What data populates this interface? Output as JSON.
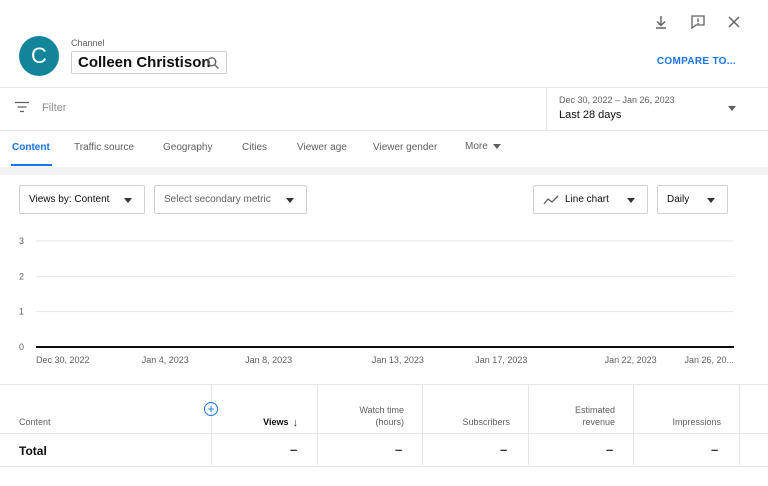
{
  "window": {
    "icons": [
      "download-icon",
      "feedback-icon",
      "close-icon"
    ]
  },
  "header": {
    "avatar_letter": "C",
    "avatar_color": "#12859a",
    "channel_label": "Channel",
    "channel_name": "Colleen Christison",
    "compare_label": "COMPARE TO..."
  },
  "filter": {
    "placeholder": "Filter"
  },
  "date": {
    "range": "Dec 30, 2022 – Jan 26, 2023",
    "label": "Last 28 days"
  },
  "tabs": [
    {
      "label": "Content",
      "active": true
    },
    {
      "label": "Traffic source"
    },
    {
      "label": "Geography"
    },
    {
      "label": "Cities"
    },
    {
      "label": "Viewer age"
    },
    {
      "label": "Viewer gender"
    },
    {
      "label": "More"
    }
  ],
  "controls": {
    "primary_metric": "Views by: Content",
    "secondary_metric": "Select secondary metric",
    "chart_type": "Line chart",
    "granularity": "Daily"
  },
  "chart_data": {
    "type": "line",
    "x_tick_labels": [
      "Dec 30, 2022",
      "Jan 4, 2023",
      "Jan 8, 2023",
      "Jan 13, 2023",
      "Jan 17, 2023",
      "Jan 22, 2023",
      "Jan 26, 20..."
    ],
    "x_tick_day_index": [
      0,
      5,
      9,
      14,
      18,
      23,
      27
    ],
    "y_ticks": [
      0,
      1,
      2,
      3
    ],
    "ylim": [
      0,
      3
    ],
    "grid": true,
    "series": [
      {
        "values": [
          0,
          0,
          0,
          0,
          0,
          0,
          0,
          0,
          0,
          0,
          0,
          0,
          0,
          0,
          0,
          0,
          0,
          0,
          0,
          0,
          0,
          0,
          0,
          0,
          0,
          0,
          0,
          0
        ],
        "color": "#0d0d0d"
      }
    ]
  },
  "table": {
    "columns": [
      {
        "label": "Content"
      },
      {
        "label": "Views",
        "sorted": true
      },
      {
        "label_line1": "Watch time",
        "label_line2": "(hours)"
      },
      {
        "label": "Subscribers"
      },
      {
        "label_line1": "Estimated",
        "label_line2": "revenue"
      },
      {
        "label": "Impressions"
      }
    ],
    "total_row": {
      "label": "Total",
      "values": [
        "–",
        "–",
        "–",
        "–",
        "–"
      ]
    }
  },
  "colors": {
    "accent": "#1a73e8",
    "text_secondary": "#606060"
  }
}
